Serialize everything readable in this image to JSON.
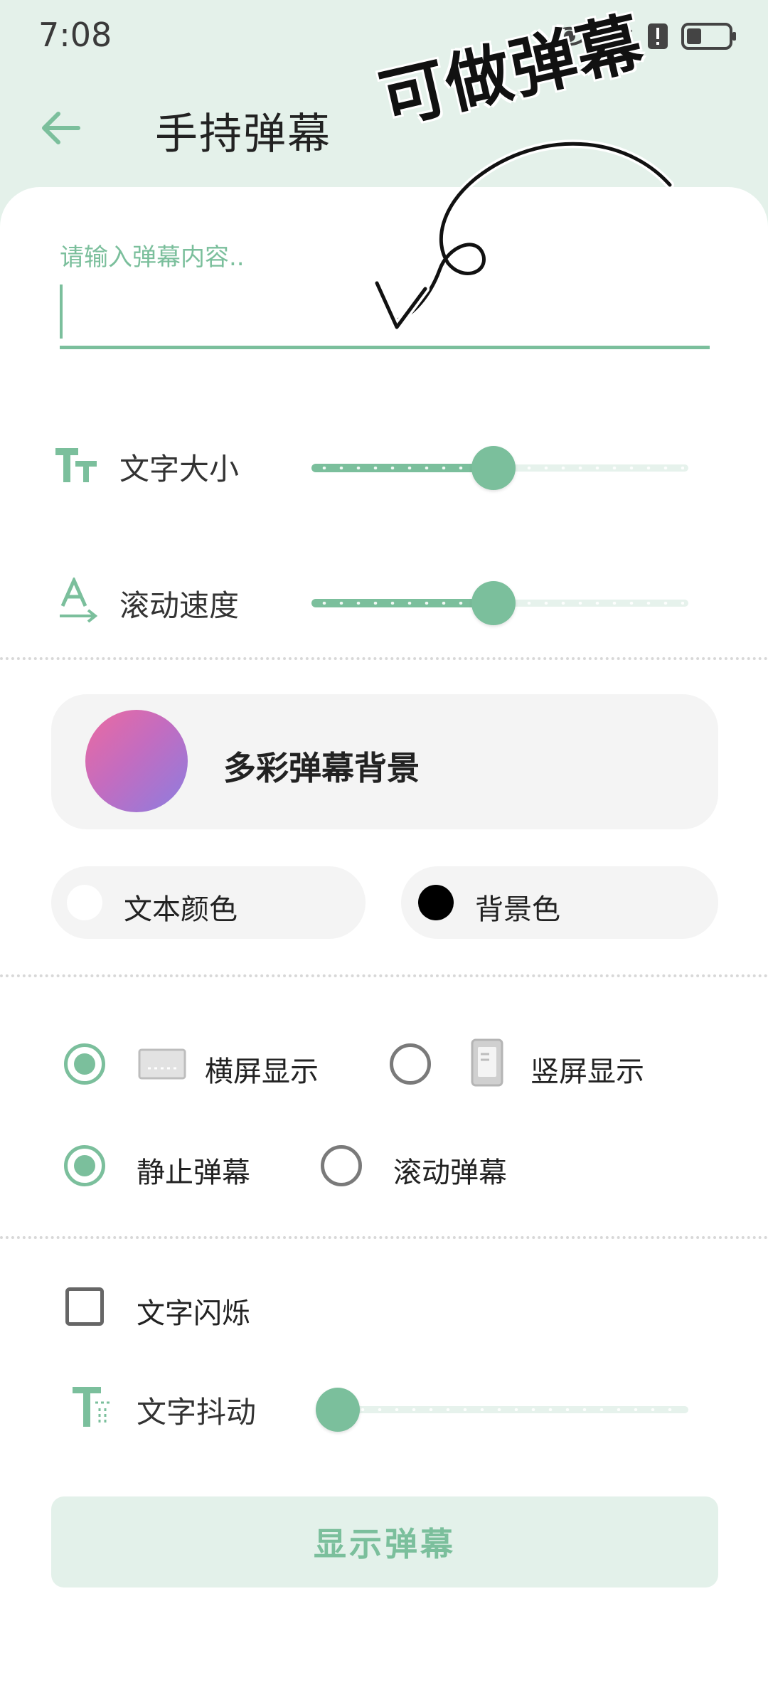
{
  "status_bar": {
    "time": "7:08"
  },
  "header": {
    "title": "手持弹幕",
    "sticker": "可做弹幕"
  },
  "input": {
    "label": "请输入弹幕内容..",
    "value": ""
  },
  "sliders": {
    "font_size": {
      "label": "文字大小",
      "value": 0.48
    },
    "scroll_speed": {
      "label": "滚动速度",
      "value": 0.48
    },
    "shake": {
      "label": "文字抖动",
      "value": 0.0
    }
  },
  "background_card": {
    "label": "多彩弹幕背景"
  },
  "colors": {
    "text_color": {
      "label": "文本颜色",
      "swatch": "#ffffff"
    },
    "background_color": {
      "label": "背景色",
      "swatch": "#000000"
    },
    "accent": "#7bbf9c"
  },
  "orientation": {
    "landscape": {
      "label": "横屏显示",
      "selected": true
    },
    "portrait": {
      "label": "竖屏显示",
      "selected": false
    }
  },
  "mode": {
    "static": {
      "label": "静止弹幕",
      "selected": true
    },
    "scrolling": {
      "label": "滚动弹幕",
      "selected": false
    }
  },
  "blink": {
    "label": "文字闪烁",
    "checked": false
  },
  "button": {
    "label": "显示弹幕"
  }
}
